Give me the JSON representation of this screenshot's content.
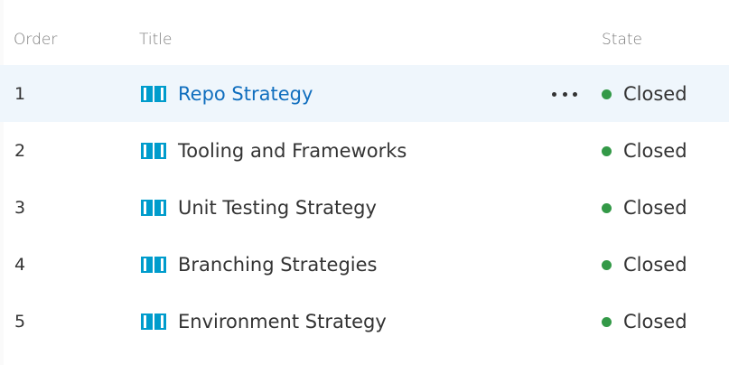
{
  "columns": {
    "order": "Order",
    "title": "Title",
    "state": "State"
  },
  "rows": [
    {
      "order": "1",
      "title": "Repo Strategy",
      "state": "Closed",
      "selected": true,
      "icon": "book-icon"
    },
    {
      "order": "2",
      "title": "Tooling and Frameworks",
      "state": "Closed",
      "selected": false,
      "icon": "book-icon"
    },
    {
      "order": "3",
      "title": "Unit Testing Strategy",
      "state": "Closed",
      "selected": false,
      "icon": "book-icon"
    },
    {
      "order": "4",
      "title": "Branching Strategies",
      "state": "Closed",
      "selected": false,
      "icon": "book-icon"
    },
    {
      "order": "5",
      "title": "Environment Strategy",
      "state": "Closed",
      "selected": false,
      "icon": "book-icon"
    }
  ],
  "colors": {
    "icon": "#009ccc",
    "state_closed": "#339947",
    "link": "#106ebe",
    "selected_row": "#eff6fc"
  },
  "more_actions_icon": "ellipsis-icon"
}
